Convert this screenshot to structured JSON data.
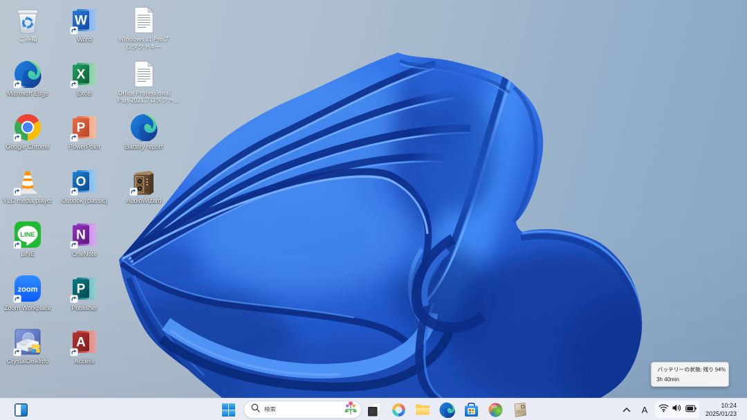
{
  "os": "Windows 11 desktop (Japanese locale)",
  "wallpaper": {
    "name": "windows-11-bloom",
    "accent": "#2a6ede"
  },
  "desktop": {
    "icons": [
      {
        "label": "ごみ箱",
        "col": 0,
        "row": 0,
        "shortcut": false
      },
      {
        "label": "Microsoft Edge",
        "col": 0,
        "row": 1,
        "shortcut": true
      },
      {
        "label": "Google Chrome",
        "col": 0,
        "row": 2,
        "shortcut": true
      },
      {
        "label": "VLC media player",
        "col": 0,
        "row": 3,
        "shortcut": true
      },
      {
        "label": "LINE",
        "col": 0,
        "row": 4,
        "shortcut": true
      },
      {
        "label": "Zoom Workplace",
        "col": 0,
        "row": 5,
        "shortcut": true
      },
      {
        "label": "CrystalDiskInfo",
        "col": 0,
        "row": 6,
        "shortcut": true
      },
      {
        "label": "Word",
        "col": 1,
        "row": 0,
        "shortcut": true
      },
      {
        "label": "Excel",
        "col": 1,
        "row": 1,
        "shortcut": true
      },
      {
        "label": "PowerPoint",
        "col": 1,
        "row": 2,
        "shortcut": true
      },
      {
        "label": "Outlook (classic)",
        "col": 1,
        "row": 3,
        "shortcut": true
      },
      {
        "label": "OneNote",
        "col": 1,
        "row": 4,
        "shortcut": true
      },
      {
        "label": "Publisher",
        "col": 1,
        "row": 5,
        "shortcut": true
      },
      {
        "label": "Access",
        "col": 1,
        "row": 6,
        "shortcut": true
      },
      {
        "label": "Windows 11 Proプロダクトキー",
        "col": 2,
        "row": 0,
        "shortcut": false
      },
      {
        "label": "Office Professional Plus 2021プロダクト...",
        "col": 2,
        "row": 1,
        "shortcut": false
      },
      {
        "label": "Battery report",
        "col": 2,
        "row": 2,
        "shortcut": false
      },
      {
        "label": "AudioWizard",
        "col": 2,
        "row": 3,
        "shortcut": true
      }
    ]
  },
  "taskbar": {
    "widgets_button": "widgets",
    "start_button": "start",
    "search": {
      "placeholder": "検索"
    },
    "pinned": [
      "task-view",
      "copilot",
      "file-explorer",
      "microsoft-edge",
      "microsoft-store",
      "colorful-sphere-app",
      "beige-utility-app"
    ],
    "tray": {
      "hidden_icons": "^",
      "ime_mode": "A",
      "status_icons": [
        "wifi",
        "volume",
        "battery"
      ],
      "time": "10:24",
      "date": "2025/01/23"
    }
  },
  "tooltip": {
    "line1": "バッテリーの状態: 残り 94%",
    "line2": "3h 40min"
  }
}
